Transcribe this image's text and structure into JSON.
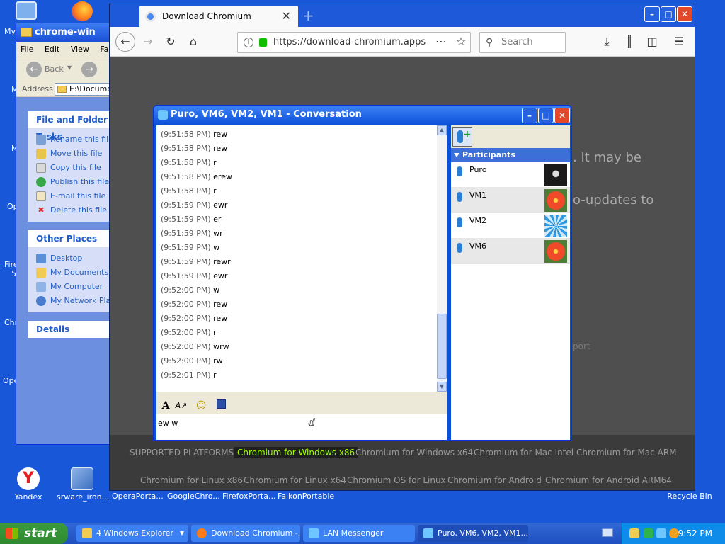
{
  "desktop": {
    "icons": [
      {
        "label": "Yandex"
      },
      {
        "label": "srware_iron..."
      },
      {
        "label": "OperaPorta..."
      },
      {
        "label": "GoogleChro..."
      },
      {
        "label": "FirefoxPorta..."
      },
      {
        "label": "FalkonPortable"
      },
      {
        "label": "Recycle Bin"
      }
    ],
    "partial_labels": [
      "My",
      "M",
      "M",
      "Op",
      "Fire",
      "5",
      "Chr",
      "Ope"
    ]
  },
  "explorer": {
    "title": "chrome-win",
    "menu": [
      "File",
      "Edit",
      "View",
      "Fa"
    ],
    "back_label": "Back",
    "address_label": "Address",
    "address_value": "E:\\Documents",
    "file_tasks": {
      "title": "File and Folder Tasks",
      "items": [
        "Rename this file",
        "Move this file",
        "Copy this file",
        "Publish this file to the Web",
        "E-mail this file",
        "Delete this file"
      ]
    },
    "other_places": {
      "title": "Other Places",
      "items": [
        "Desktop",
        "My Documents",
        "My Computer",
        "My Network Places"
      ]
    },
    "details_title": "Details"
  },
  "browser": {
    "tab_title": "Download Chromium",
    "url": "https://download-chromium.apps",
    "search_placeholder": "Search",
    "bg_text_1": ". It may be",
    "bg_text_2": "o-updates to",
    "bg_text_3": "port",
    "footer": {
      "label": "SUPPORTED PLATFORMS:",
      "row1": [
        "Chromium for Windows x86",
        "Chromium for Windows x64",
        "Chromium for Mac Intel",
        "Chromium for Mac ARM"
      ],
      "row2": [
        "Chromium for Linux x86",
        "Chromium for Linux x64",
        "Chromium OS for Linux",
        "Chromium for Android",
        "Chromium for Android ARM64"
      ]
    }
  },
  "conversation": {
    "title": "Puro, VM6, VM2, VM1 - Conversation",
    "messages": [
      {
        "time": "(9:51:58 PM)",
        "text": "rew"
      },
      {
        "time": "(9:51:58 PM)",
        "text": "rew"
      },
      {
        "time": "(9:51:58 PM)",
        "text": "r"
      },
      {
        "time": "(9:51:58 PM)",
        "text": "erew"
      },
      {
        "time": "(9:51:58 PM)",
        "text": "r"
      },
      {
        "time": "(9:51:59 PM)",
        "text": "ewr"
      },
      {
        "time": "(9:51:59 PM)",
        "text": "er"
      },
      {
        "time": "(9:51:59 PM)",
        "text": "wr"
      },
      {
        "time": "(9:51:59 PM)",
        "text": "w"
      },
      {
        "time": "(9:51:59 PM)",
        "text": "rewr"
      },
      {
        "time": "(9:51:59 PM)",
        "text": "ewr"
      },
      {
        "time": "(9:52:00 PM)",
        "text": "w"
      },
      {
        "time": "(9:52:00 PM)",
        "text": "rew"
      },
      {
        "time": "(9:52:00 PM)",
        "text": "rew"
      },
      {
        "time": "(9:52:00 PM)",
        "text": "r"
      },
      {
        "time": "(9:52:00 PM)",
        "text": "wrw"
      },
      {
        "time": "(9:52:00 PM)",
        "text": "rw"
      },
      {
        "time": "(9:52:01 PM)",
        "text": "r"
      }
    ],
    "input_value": "ew w",
    "participants_header": "Participants",
    "participants": [
      "Puro",
      "VM1",
      "VM2",
      "VM6"
    ]
  },
  "taskbar": {
    "start_label": "start",
    "tasks": [
      "4 Windows Explorer",
      "Download Chromium -...",
      "LAN Messenger",
      "Puro, VM6, VM2, VM1..."
    ],
    "clock": "9:52 PM"
  }
}
